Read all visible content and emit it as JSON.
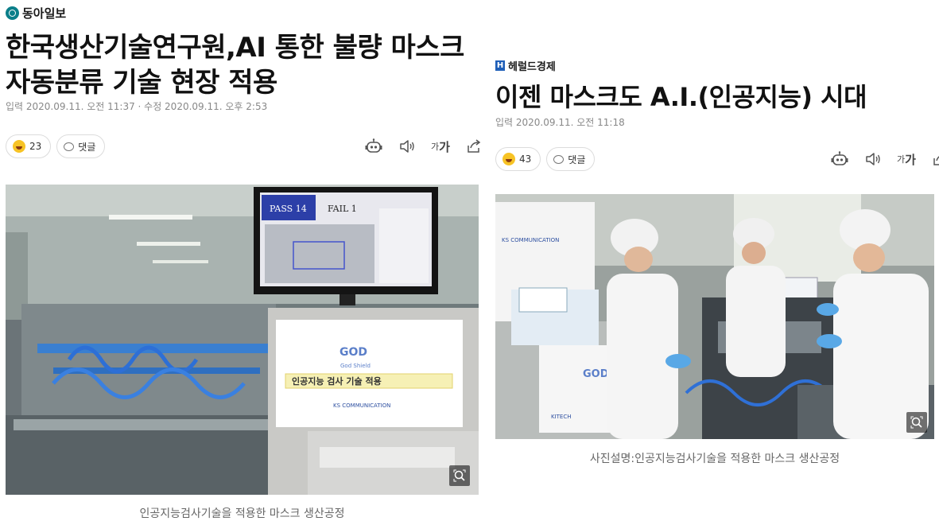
{
  "left_article": {
    "brand": "동아일보",
    "headline_line1": "한국생산기술연구원,AI 통한 불량 마스크",
    "headline_line2": "자동분류 기술 현장 적용",
    "meta": "입력 2020.09.11. 오전 11:37 · 수정 2020.09.11. 오후 2:53",
    "reaction_count": "23",
    "comment_label": "댓글",
    "font_label_small": "가",
    "font_label_large": "가",
    "caption": "인공지능검사기술을 적용한 마스크 생산공정",
    "photo_monitor_pass": "PASS 14",
    "photo_monitor_fail": "FAIL 1",
    "photo_panel_text": "인공지능 검사 기술 적용",
    "photo_panel_brand": "God Shield",
    "photo_panel_company": "KS COMMUNICATION",
    "photo_panel_kitech": "KITECH"
  },
  "right_article": {
    "brand": "헤럴드경제",
    "headline": "이젠 마스크도 A.I.(인공지능) 시대",
    "meta": "입력 2020.09.11. 오전 11:18",
    "reaction_count": "43",
    "comment_label": "댓글",
    "font_label_small": "가",
    "font_label_large": "가",
    "caption": "사진설명:인공지능검사기술을 적용한 마스크 생산공정",
    "photo_panel_company": "KS COMMUNICATION",
    "photo_panel_kitech": "KITECH"
  },
  "icons": {
    "reaction": "smile-emoji-icon",
    "comment": "speech-bubble-icon",
    "robot": "robot-icon",
    "audio": "speaker-icon",
    "share": "share-icon",
    "zoom": "zoom-icon"
  },
  "colors": {
    "donga_logo": "#0b7f8a",
    "herald_logo": "#1f5fb8",
    "meta_text": "#888888",
    "caption_text": "#666666"
  }
}
